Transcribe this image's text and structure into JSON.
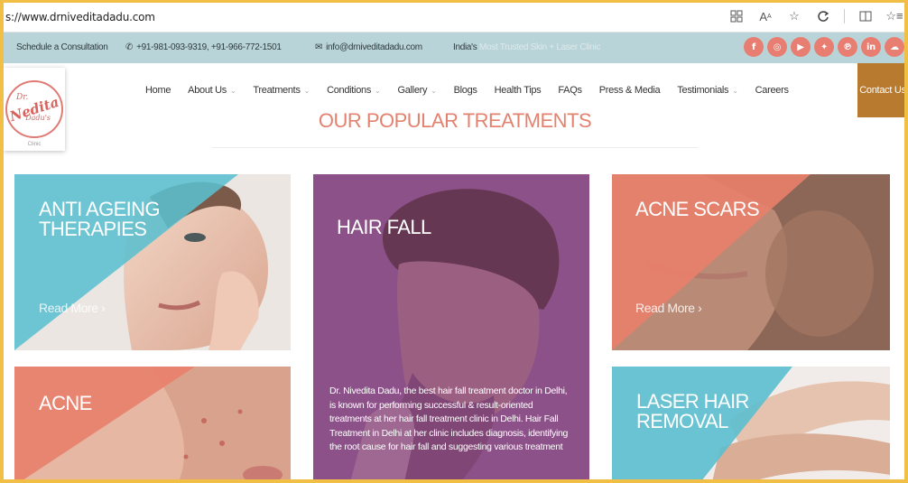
{
  "browser": {
    "url": "s://www.drniveditadadu.com",
    "icons": [
      "grid-icon",
      "read-aloud-icon",
      "favorite-star-icon",
      "refresh-icon",
      "split-screen-icon",
      "favorites-list-icon"
    ]
  },
  "infobar": {
    "schedule": "Schedule a Consultation",
    "phone": "+91-981-093-9319, +91-966-772-1501",
    "email": "info@drniveditadadu.com",
    "tagline_prefix": "India's",
    "tagline_rest": "Most Trusted Skin + Laser Clinic",
    "socials": [
      "f",
      "ig",
      "yt",
      "tw",
      "p",
      "in",
      "cl"
    ]
  },
  "logo": {
    "dr": "Dr.",
    "main": "Nedita",
    "sub": "Dadu's",
    "clinic": "Clinic"
  },
  "nav": {
    "items": [
      {
        "label": "Home",
        "dropdown": false
      },
      {
        "label": "About Us",
        "dropdown": true
      },
      {
        "label": "Treatments",
        "dropdown": true
      },
      {
        "label": "Conditions",
        "dropdown": true
      },
      {
        "label": "Gallery",
        "dropdown": true
      },
      {
        "label": "Blogs",
        "dropdown": false
      },
      {
        "label": "Health Tips",
        "dropdown": false
      },
      {
        "label": "FAQs",
        "dropdown": false
      },
      {
        "label": "Press & Media",
        "dropdown": false
      },
      {
        "label": "Testimonials",
        "dropdown": true
      },
      {
        "label": "Careers",
        "dropdown": false
      }
    ],
    "contact": "Contact Us"
  },
  "section_title": "OUR POPULAR TREATMENTS",
  "cards": {
    "anti_ageing": {
      "title1": "ANTI AGEING",
      "title2": "THERAPIES",
      "read_more": "Read More ›"
    },
    "hair_fall": {
      "title": "HAIR FALL",
      "desc": "Dr. Nivedita Dadu, the best hair fall treatment doctor in Delhi, is known for performing successful & result-oriented treatments at her hair fall treatment clinic in Delhi. Hair Fall Treatment in Delhi at her clinic includes diagnosis, identifying the root cause for hair fall and suggesting various treatment"
    },
    "acne_scars": {
      "title": "ACNE SCARS",
      "read_more": "Read More ›"
    },
    "acne": {
      "title": "ACNE"
    },
    "laser": {
      "title1": "LASER HAIR",
      "title2": "REMOVAL"
    }
  },
  "colors": {
    "teal": "#5bbfcf",
    "coral": "#e8806c",
    "purple": "#8b4d86",
    "gold": "#b77a2e",
    "infobar": "#b9d4d8"
  }
}
